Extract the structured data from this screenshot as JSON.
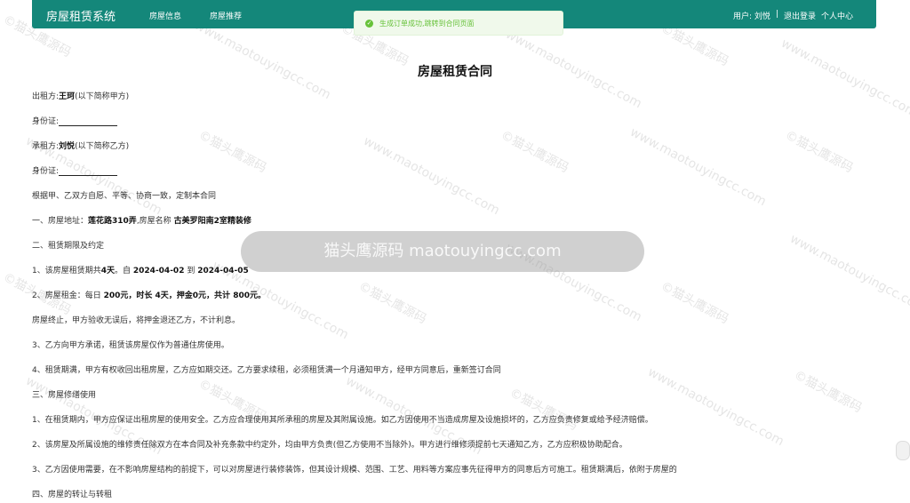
{
  "nav": {
    "brand": "房屋租赁系统",
    "items": [
      "房屋信息",
      "房屋推荐"
    ],
    "user_label": "用户: 刘悦",
    "sep": "|",
    "logout": "退出登录",
    "profile": "个人中心"
  },
  "toast": {
    "message": "生成订单成功,跳转到合同页面"
  },
  "contract": {
    "title": "房屋租赁合同",
    "lessor_prefix": "出租方:",
    "lessor_name": "王珂",
    "lessor_suffix": "(以下简称甲方)",
    "id_label_1": "身份证:",
    "lessee_prefix": "承租方:",
    "lessee_name": "刘悦",
    "lessee_suffix": "(以下简称乙方)",
    "id_label_2": "身份证:",
    "preamble": "根据甲、乙双方自愿、平等、协商一致，定制本合同",
    "s1_prefix": "一、房屋地址：",
    "address": "莲花路310弄",
    "s1_mid": ",房屋名称",
    "house_name": "古美罗阳南2室精装修",
    "s2": "二、租赁期限及约定",
    "p1_a": "1、该房屋租赁期共",
    "days": "4天",
    "p1_b": "。自",
    "start": "2024-04-02",
    "p1_c": "到",
    "end": "2024-04-05",
    "p2_a": "2、房屋租金：每日",
    "p2_bold": "200元，时长 4天，押金0元，共计 800元。",
    "p_refund": "房屋终止，甲方验收无误后，将押金退还乙方，不计利息。",
    "p3": "3、乙方向甲方承诺，租赁该房屋仅作为普通住房使用。",
    "p4": "4、租赁期满，甲方有权收回出租房屋，乙方应如期交还。乙方要求续租，必须租赁满一个月通知甲方，经甲方同意后，重新签订合同",
    "s3": "三、房屋修缮使用",
    "m1": "1、在租赁期内，甲方应保证出租房屋的使用安全。乙方应合理使用其所承租的房屋及其附属设施。如乙方因使用不当造成房屋及设施损坏的，乙方应负责修复或给予经济赔偿。",
    "m2": "2、该房屋及所属设施的维修责任除双方在本合同及补充条款中约定外，均由甲方负责(但乙方使用不当除外)。甲方进行维修须提前七天通知乙方，乙方应积极协助配合。",
    "m3": "3、乙方因使用需要，在不影响房屋结构的前提下，可以对房屋进行装修装饰，但其设计规模、范围、工艺、用料等方案应事先征得甲方的同意后方可施工。租赁期满后，依附于房屋的",
    "s4": "四、房屋的转让与转租"
  },
  "watermark": {
    "text": "©猫头鹰源码",
    "url": "www.maotouyingcc.com",
    "banner": "猫头鹰源码 maotouyingcc.com"
  },
  "colors": {
    "nav_bg": "#14877a",
    "toast_bg": "#f0f9eb",
    "toast_fg": "#67c23a"
  }
}
